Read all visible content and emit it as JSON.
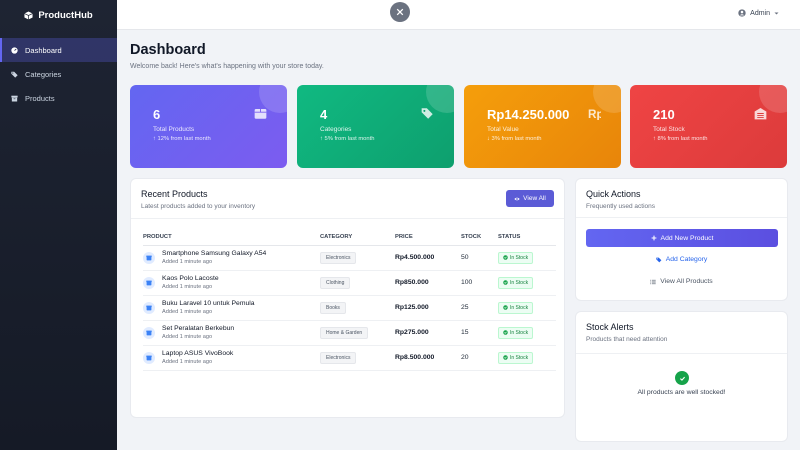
{
  "sidebar": {
    "brand": "ProductHub",
    "items": [
      {
        "label": "Dashboard",
        "icon": "gauge-icon",
        "active": true
      },
      {
        "label": "Categories",
        "icon": "tags-icon",
        "active": false
      },
      {
        "label": "Products",
        "icon": "box-icon",
        "active": false
      }
    ]
  },
  "topbar": {
    "user": "Admin"
  },
  "header": {
    "title": "Dashboard",
    "subtitle": "Welcome back! Here's what's happening with your store today."
  },
  "stats": [
    {
      "value": "6",
      "label": "Total Products",
      "change": "12% from last month",
      "change_dir": "up",
      "color": "#6366f1",
      "icon": "box-icon"
    },
    {
      "value": "4",
      "label": "Categories",
      "change": "5% from last month",
      "change_dir": "up",
      "color": "#10b981",
      "icon": "tags-icon"
    },
    {
      "value": "Rp14.250.000",
      "label": "Total Value",
      "change": "3% from last month",
      "change_dir": "down",
      "color": "#f59e0b",
      "icon": "rupiah-icon"
    },
    {
      "value": "210",
      "label": "Total Stock",
      "change": "8% from last month",
      "change_dir": "up",
      "color": "#ef4444",
      "icon": "warehouse-icon"
    }
  ],
  "recent": {
    "title": "Recent Products",
    "subtitle": "Latest products added to your inventory",
    "view_all": "View All",
    "columns": [
      "PRODUCT",
      "CATEGORY",
      "PRICE",
      "STOCK",
      "STATUS"
    ],
    "rows": [
      {
        "name": "Smartphone Samsung Galaxy A54",
        "added": "Added 1 minute ago",
        "category": "Electronics",
        "price": "Rp4.500.000",
        "stock": "50",
        "status": "In Stock"
      },
      {
        "name": "Kaos Polo Lacoste",
        "added": "Added 1 minute ago",
        "category": "Clothing",
        "price": "Rp850.000",
        "stock": "100",
        "status": "In Stock"
      },
      {
        "name": "Buku Laravel 10 untuk Pemula",
        "added": "Added 1 minute ago",
        "category": "Books",
        "price": "Rp125.000",
        "stock": "25",
        "status": "In Stock"
      },
      {
        "name": "Set Peralatan Berkebun",
        "added": "Added 1 minute ago",
        "category": "Home & Garden",
        "price": "Rp275.000",
        "stock": "15",
        "status": "In Stock"
      },
      {
        "name": "Laptop ASUS VivoBook",
        "added": "Added 1 minute ago",
        "category": "Electronics",
        "price": "Rp8.500.000",
        "stock": "20",
        "status": "In Stock"
      }
    ]
  },
  "quick": {
    "title": "Quick Actions",
    "subtitle": "Frequently used actions",
    "add_product": "Add New Product",
    "add_category": "Add Category",
    "view_products": "View All Products"
  },
  "alerts": {
    "title": "Stock Alerts",
    "subtitle": "Products that need attention",
    "message": "All products are well stocked!"
  }
}
